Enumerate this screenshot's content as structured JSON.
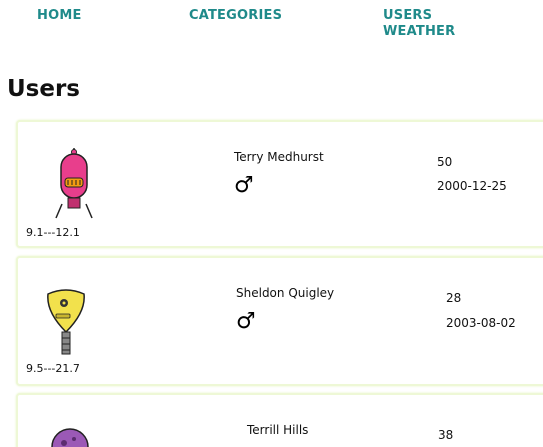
{
  "nav": {
    "home": "HOME",
    "categories": "CATEGORIES",
    "users": "USERS",
    "weather": "WEATHER"
  },
  "page": {
    "title": "Users"
  },
  "users": [
    {
      "name": "Terry Medhurst",
      "gender_symbol": "♂",
      "age": "50",
      "birthdate": "2000-12-25",
      "range": "9.1---12.1",
      "avatar_icon": "pink-robot-avatar",
      "avatar_color": "#e83e8c"
    },
    {
      "name": "Sheldon Quigley",
      "gender_symbol": "♂",
      "age": "28",
      "birthdate": "2003-08-02",
      "range": "9.5---21.7",
      "avatar_icon": "yellow-robot-avatar",
      "avatar_color": "#f2e14c"
    },
    {
      "name": "Terrill Hills",
      "age": "38",
      "avatar_icon": "purple-robot-avatar",
      "avatar_color": "#9b59b6"
    }
  ],
  "colors": {
    "nav_link": "#1f8a8a",
    "card_border": "#eef8d6"
  }
}
